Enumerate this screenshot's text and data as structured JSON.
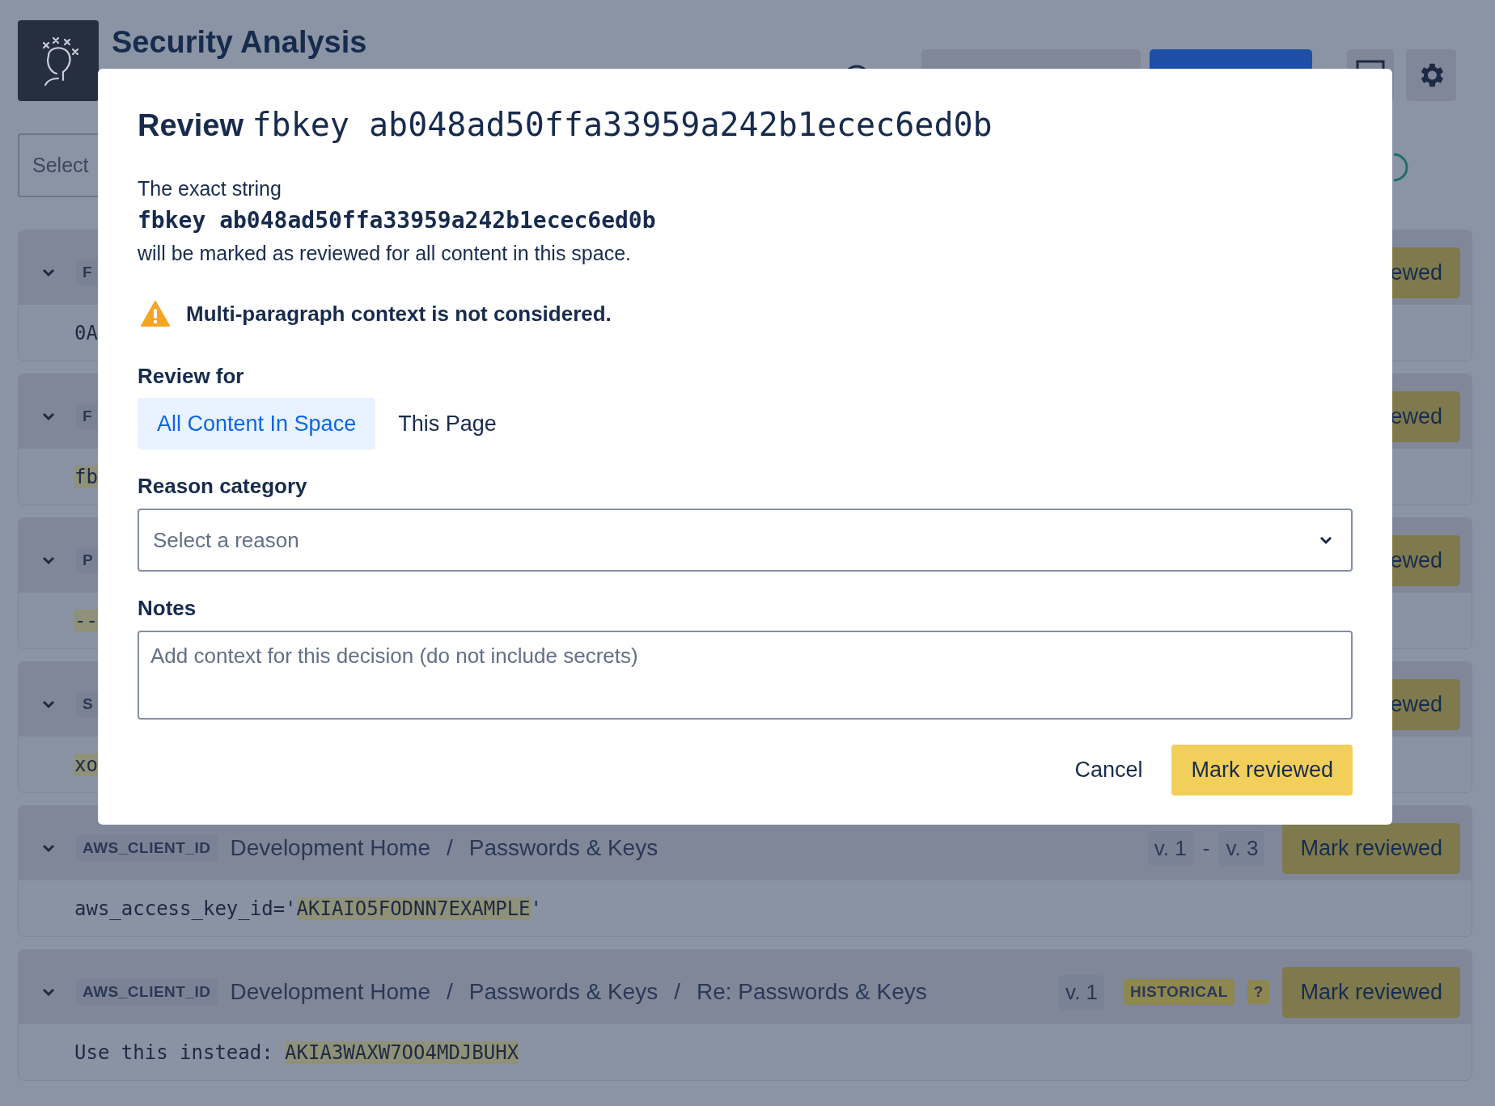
{
  "header": {
    "title": "Security Analysis"
  },
  "filter": {
    "placeholder": "Select"
  },
  "findings": [
    {
      "expanded": true,
      "tag": "F",
      "snippet": [
        {
          "text": "0A",
          "highlight": false
        }
      ],
      "action": "ewed"
    },
    {
      "expanded": true,
      "tag": "F",
      "snippet": [
        {
          "text": "fb",
          "highlight": true
        }
      ],
      "action": "ewed"
    },
    {
      "expanded": true,
      "tag": "P",
      "snippet": [
        {
          "text": "--",
          "highlight": true
        }
      ],
      "action": "ewed"
    },
    {
      "expanded": true,
      "tag": "S",
      "snippet": [
        {
          "text": "xo",
          "highlight": true
        }
      ],
      "action": "ewed"
    },
    {
      "expanded": true,
      "tag": "AWS_CLIENT_ID",
      "path": [
        {
          "kind": "crumb",
          "text": "Development Home"
        },
        {
          "kind": "separator",
          "text": "/"
        },
        {
          "kind": "crumb",
          "text": "Passwords & Keys"
        }
      ],
      "versions": [
        {
          "kind": "version",
          "text": "v. 1"
        },
        {
          "kind": "dash",
          "text": "-"
        },
        {
          "kind": "version",
          "text": "v. 3"
        }
      ],
      "snippet": [
        {
          "text": "aws_access_key_id='",
          "highlight": false
        },
        {
          "text": "AKIAIO5FODNN7EXAMPLE",
          "highlight": true
        },
        {
          "text": "'",
          "highlight": false
        }
      ],
      "action": "Mark reviewed"
    },
    {
      "expanded": true,
      "tag": "AWS_CLIENT_ID",
      "path": [
        {
          "kind": "crumb",
          "text": "Development Home"
        },
        {
          "kind": "separator",
          "text": "/"
        },
        {
          "kind": "crumb",
          "text": "Passwords & Keys"
        },
        {
          "kind": "separator",
          "text": "/"
        },
        {
          "kind": "crumb",
          "text": "Re: Passwords & Keys"
        }
      ],
      "versions": [
        {
          "kind": "version",
          "text": "v. 1"
        }
      ],
      "badges": [
        {
          "kind": "status",
          "text": "HISTORICAL"
        },
        {
          "kind": "help",
          "text": "?"
        }
      ],
      "snippet": [
        {
          "text": "Use this instead: ",
          "highlight": false
        },
        {
          "text": "AKIA3WAXW7OO4MDJBUHX",
          "highlight": true
        }
      ],
      "action": "Mark reviewed"
    }
  ],
  "dialog": {
    "title": "Review",
    "title_code": "fbkey ab048ad50ffa33959a242b1ecec6ed0b",
    "intro": "The exact string",
    "string": "fbkey ab048ad50ffa33959a242b1ecec6ed0b",
    "scope_note": "will be marked as reviewed for all content in this space.",
    "warning": "Multi-paragraph context is not considered.",
    "review_for": {
      "label": "Review for",
      "options": [
        {
          "label": "All Content In Space",
          "selected": true
        },
        {
          "label": "This Page",
          "selected": false
        }
      ]
    },
    "reason": {
      "label": "Reason category",
      "placeholder": "Select a reason"
    },
    "notes": {
      "label": "Notes",
      "placeholder": "Add context for this decision (do not include secrets)"
    },
    "buttons": [
      {
        "kind": "secondary",
        "label": "Cancel"
      },
      {
        "kind": "primary",
        "label": "Mark reviewed"
      }
    ]
  }
}
